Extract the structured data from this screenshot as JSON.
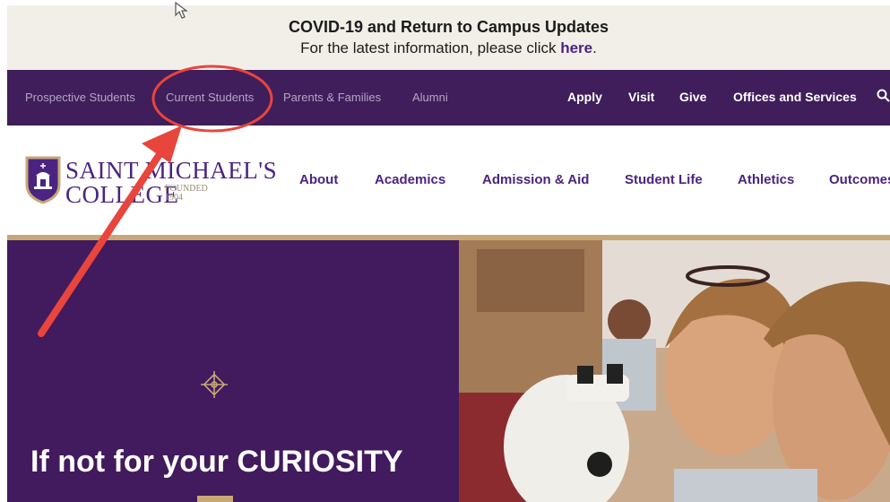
{
  "alert": {
    "title": "COVID-19 and Return to Campus Updates",
    "text": "For the latest information, please click ",
    "link": "here",
    "end": "."
  },
  "utility_nav": {
    "audience": [
      "Prospective Students",
      "Current Students",
      "Parents & Families",
      "Alumni"
    ],
    "actions": [
      "Apply",
      "Visit",
      "Give",
      "Offices and Services"
    ],
    "search_icon": "search-icon"
  },
  "logo": {
    "line1": "SAINT MICHAEL'S",
    "line2": "COLLEGE",
    "founded_label": "FOUNDED",
    "founded_year": "1904"
  },
  "main_nav": [
    "About",
    "Academics",
    "Admission & Aid",
    "Student Life",
    "Athletics",
    "Outcomes"
  ],
  "hero": {
    "headline": "If not for your CURIOSITY",
    "ornament_icon": "cross-ornament-icon"
  },
  "colors": {
    "purple": "#3f1e5b",
    "accent_purple": "#4a2480",
    "gold": "#c7a875",
    "annotation_red": "#e8453c"
  }
}
